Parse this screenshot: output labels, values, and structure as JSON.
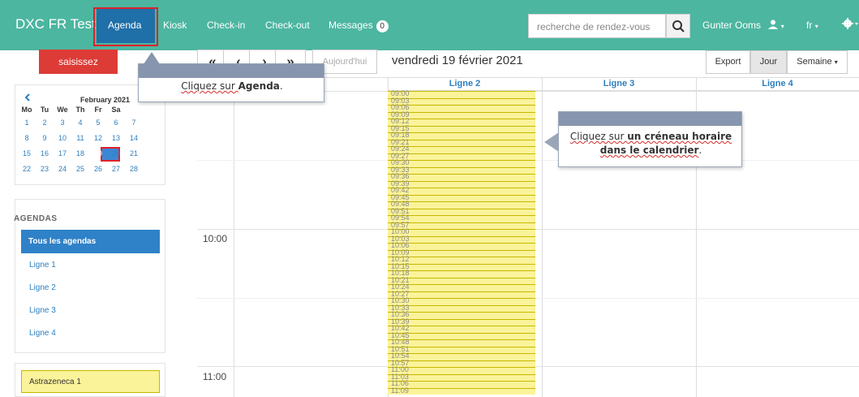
{
  "navbar": {
    "brand": "DXC FR Test",
    "items": [
      "Agenda",
      "Kiosk",
      "Check-in",
      "Check-out",
      "Messages"
    ],
    "messages_badge": "0",
    "search_placeholder": "recherche de rendez-vous",
    "user_name": "Gunter Ooms",
    "lang": "fr",
    "bg_color": "#4cb6a0",
    "active_color": "#1f6fa8"
  },
  "sidebar": {
    "add_button": "saisissez",
    "mini_calendar": {
      "month_title": "February 2021",
      "weekdays": [
        "Mo",
        "Tu",
        "We",
        "Th",
        "Fr",
        "Sa"
      ],
      "weeks": [
        [
          "1",
          "2",
          "3",
          "4",
          "5",
          "6",
          "7"
        ],
        [
          "8",
          "9",
          "10",
          "11",
          "12",
          "13",
          "14"
        ],
        [
          "15",
          "16",
          "17",
          "18",
          "19",
          "20",
          "21"
        ],
        [
          "22",
          "23",
          "24",
          "25",
          "26",
          "27",
          "28"
        ]
      ],
      "selected_day": "19"
    },
    "agendas_header": "AGENDAS",
    "agendas": [
      "Tous les agendas",
      "Ligne 1",
      "Ligne 2",
      "Ligne 3",
      "Ligne 4"
    ],
    "active_agenda": "Tous les agendas",
    "appointment_type": "Astrazeneca 1"
  },
  "toolbar": {
    "prev_prev": "«",
    "prev": "‹",
    "next": "›",
    "next_next": "»",
    "today": "Aujourd'hui",
    "date_title": "vendredi 19 février 2021",
    "export": "Export",
    "day": "Jour",
    "week": "Semaine"
  },
  "calendar": {
    "columns": [
      "Ligne 2",
      "Ligne 3",
      "Ligne 4"
    ],
    "time_labels": [
      "10:00",
      "11:00"
    ],
    "slots": [
      "09:00",
      "09:03",
      "09:06",
      "09:09",
      "09:12",
      "09:15",
      "09:18",
      "09:21",
      "09:24",
      "09:27",
      "09:30",
      "09:33",
      "09:36",
      "09:39",
      "09:42",
      "09:45",
      "09:48",
      "09:51",
      "09:54",
      "09:57",
      "10:00",
      "10:03",
      "10:06",
      "10:09",
      "10:12",
      "10:15",
      "10:18",
      "10:21",
      "10:24",
      "10:27",
      "10:30",
      "10:33",
      "10:36",
      "10:39",
      "10:42",
      "10:45",
      "10:48",
      "10:51",
      "10:54",
      "10:57",
      "11:00",
      "11:03",
      "11:06",
      "11:09"
    ],
    "slot_color": "#fbf39a"
  },
  "tooltips": {
    "agenda_tip": {
      "prefix": "Cliquez sur ",
      "bold": "Agenda",
      "suffix": "."
    },
    "slot_tip": {
      "line1_prefix": "Cliquez sur ",
      "line1_bold": "un créneau horaire",
      "line2_bold": "dans le calendrier",
      "suffix": "."
    }
  }
}
